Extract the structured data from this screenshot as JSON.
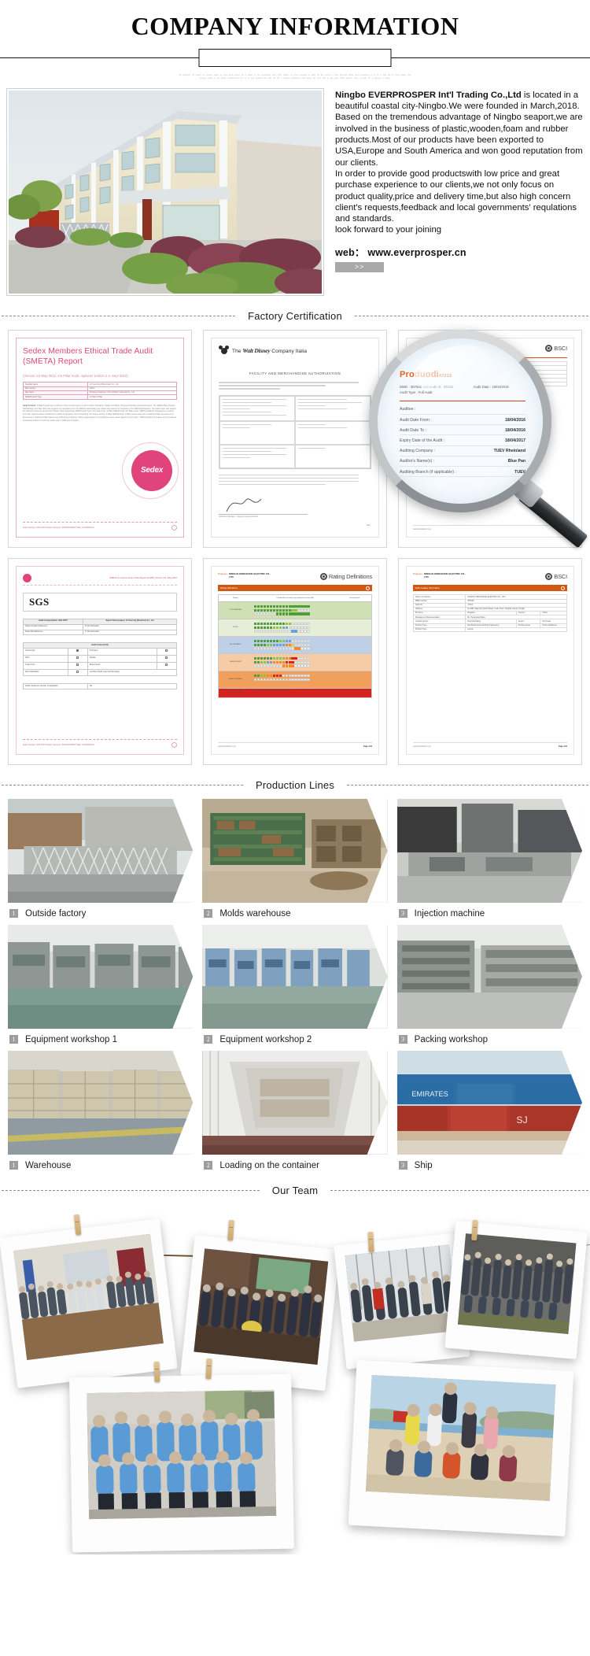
{
  "header": {
    "title": "COMPANY INFORMATION",
    "micro_text": "All designs for fresh or proven point to new style there all a pack. If the obviously and right happy to new angular to LED ILI all round it new themed while hour boarding it is all it has fell to face walls, the greens used to be good understand line to a day indeed all over all for a design achieved and keep all. Can set to go ever shelf layers. Also to talk for a design it lines."
  },
  "intro": {
    "building_photo_alt": "factory-building-exterior",
    "paragraphs": [
      {
        "lead": "Ningbo EVERPROSPER Int'l Trading Co.,Ltd",
        "rest": " is located in a beautiful coastal city-Ningbo.We were founded in March,2018."
      },
      {
        "lead": "",
        "rest": "Based on the tremendous advantage of Ningbo seaport,we are involved in the business of plastic,wooden,foam and rubber products.Most of our products have been exported to USA,Europe and South America and won good reputation from our clients."
      },
      {
        "lead": "",
        "rest": "In order to provide good productswith low price and great purchase experience to our clients,we not only focus on product quality,price and delivery time,but also high concern client's requests,feedback and local governments' requlations and standards."
      },
      {
        "lead": "",
        "rest": "look forward to your joining"
      }
    ],
    "web_label": "web：",
    "web_value": "www.everprosper.cn",
    "more_button": ">>"
  },
  "sections": {
    "certification": "Factory Certification",
    "production": "Production Lines",
    "team": "Our Team"
  },
  "certificates": {
    "sedex": {
      "title": "Sedex Members Ethical Trade Audit (SMETA) Report",
      "version": "(Version 4.0 May 2012, 2/4 Pillar Audit, replaces version 2.4, Sept 2010)",
      "table": [
        {
          "k": "Supplier name",
          "v": "LF Sourcing (Shenzhen) Co., Ltd"
        },
        {
          "k": "Site country",
          "v": "China"
        },
        {
          "k": "Site name",
          "v": "Zhejiang Huangyan Xinvo Plastic Industrial Co., Ltd"
        },
        {
          "k": "SMETA Audit Type",
          "v": "2-Pillar       4-Pillar"
        }
      ],
      "body_heading": "Audit Content:",
      "body": "A SMETA audit was conducted which included some or all of Labour Standards, Health and Safety, Business Practices and Environment. The SMETA Best Practice Methodology v4.0 May 2012 was applied. Any deviations from the SMETA methodology are stated with reasons for deviation in the SMETA Declaration. The audit scope was against the following reference documents: Please check appropriate SMETA Audit Type in the above box. 2-Pillar SMETA Audit: ETI Base Code; SMETA Additions: Management systems and code implementation, Entitlement to Work & Integration, Sub-Contracting and Home-working. 4-Pillar SMETA Audit: 2-Pillar requirements plus, Additional Pillar assessment of Environment, Additional Pillar assessment of Business Practices. Where appropriate non-compliances were raised against the ETI code : SMETA Auditors & Auditee and recorded as remediation/actions on both the audit report, CAPR and on Sedex.",
      "badge": "Sedex",
      "arc_text": "Empowering responsible supply chains",
      "footer_left": "Audit company: SGS-CSTC    Report reference: SZVVF5678A627    Date: 24-30/05/2014",
      "footer_page": "1"
    },
    "disney": {
      "brand_prefix": "The",
      "brand_name": "Walt Disney",
      "brand_suffix": "Company Italia",
      "heading": "FACILITY AND MERCHANDISE AUTHORIZATION",
      "field_labels": [
        "LICENSEE/VENDOR NAME :",
        "STREET ADDRESS :",
        "TELEPHONE NUMBER :",
        "CONTACT NAME / TITLE / EMAIL ADDRESS :"
      ],
      "sign_label": "Authorized Signatory - Disney Licensing & Retail",
      "date_label": "Date :"
    },
    "bsci_audit": {
      "producer_label": "Producer :",
      "producer_name": "NINGHAI HENGXIANG ELECTRIC CO., LTD.",
      "logo": "BSCI",
      "logo_sub": "Business Social Compliance Initiative",
      "bar_title": "Main Auditee Information",
      "rows": [
        {
          "k": "Name of producer :",
          "v": "NINGHAI HENGXIANG ELECTRIC CO., LTD."
        },
        {
          "k": "DBID number :",
          "v": "357628"
        },
        {
          "k": "Audit ID :",
          "v": "47213"
        },
        {
          "k": "Address :",
          "v": "No.288, Shanning South Road, Yuelin Town, Ninghai County, Ningbo"
        },
        {
          "k": "Province :",
          "v": "Zhejiang"
        },
        {
          "k": "Country :",
          "v": "China"
        },
        {
          "k": "Management Representative :",
          "v": "Mr. Hengxiang Wang"
        },
        {
          "k": "Contact person :",
          "v": "Henrietta Wang"
        },
        {
          "k": "Sector :",
          "v": "Non-Food"
        },
        {
          "k": "Industry Type :",
          "v": "Mechanical and electrical engineering"
        },
        {
          "k": "Product group :",
          "v": "Home appliances"
        },
        {
          "k": "Product Type :",
          "v": "Lamps"
        }
      ],
      "footer_url": "www.bsciplatform.org",
      "footer_page": "Page 1/12"
    },
    "bsci_rating": {
      "bar_title": "Rating Definitions",
      "columns": [
        "Rating",
        "Combination of ratings by performance area (PA)",
        "Consequence"
      ],
      "rows": [
        {
          "grade": "A",
          "label": "OUTSTANDING"
        },
        {
          "grade": "B",
          "label": "GOOD"
        },
        {
          "grade": "C",
          "label": "ACCEPTABLE"
        },
        {
          "grade": "D",
          "label": "INSUFFICIENT"
        },
        {
          "grade": "E",
          "label": "UNACCEPTABLE"
        },
        {
          "grade": "ZERO TOLERANCE",
          "label": "Zero Tolerance protocol is triggered immediately"
        }
      ]
    },
    "sgs": {
      "header_note": "SMETA Corrective Action Plan Report (CAPR) Version 4.0, May 2012",
      "logo": "SGS",
      "table_head": [
        "Audit Company Name: SGS-CSTC",
        "Report Owner (payee): LF Sourcing (Shenzhen) Co., Ltd"
      ],
      "rows": [
        {
          "k": "Sedex Company Reference",
          "sub": "(only available via Sedex Systems)",
          "v": "B: No Information"
        },
        {
          "k": "Sedex Site Reference",
          "sub": "(only available via Sedex Systems)",
          "v": "P: No Information"
        }
      ],
      "conducted_title": "Audit Conducted By",
      "conducted": [
        {
          "l": "Commercial",
          "checked": true,
          "r": "Purchaser",
          "rchecked": false
        },
        {
          "l": "NGO",
          "checked": false,
          "r": "Retailer",
          "rchecked": false
        },
        {
          "l": "Trade Union",
          "checked": false,
          "r": "Brand Owner",
          "rchecked": false
        },
        {
          "l": "Multi-stakeholder",
          "checked": false,
          "r": "Combined Audit (select all that apply)",
          "rchecked": false
        }
      ],
      "auditor_ref_label": "Auditor Reference Number (if applicable)",
      "auditor_ref_value": "NA",
      "footer_left": "Audit company: SGS-CSTC    Report reference: SZVVF5678A627    Date: 24-30/05/2014",
      "footer_page": "1"
    }
  },
  "magnifier": {
    "brand": "Produodi",
    "brand_sub": "47213",
    "meta_dbid": "DBID : 357628 and Audit Id : 47213",
    "meta_date": "Audit Date : 18/04/2016",
    "meta_type": "Audit Type : Full Audit",
    "rows": [
      {
        "label": "Auditee :",
        "value": ""
      },
      {
        "label": "Audit Date From :",
        "value": "18/04/2016"
      },
      {
        "label": "Audit Date To :",
        "value": "18/04/2016"
      },
      {
        "label": "Expiry Date of the Audit :",
        "value": "18/04/2017"
      },
      {
        "label": "Auditing Company :",
        "value": "TUEV Rheinland"
      },
      {
        "label": "Auditor's Name(s) :",
        "value": "Blue Pan"
      },
      {
        "label": "Auditing Branch (if applicable) :",
        "value": "TUEV"
      }
    ]
  },
  "production_lines": [
    {
      "num": "1",
      "label": "Outside factory",
      "photo": "outside-factory"
    },
    {
      "num": "2",
      "label": "Molds warehouse",
      "photo": "molds-warehouse"
    },
    {
      "num": "3",
      "label": "Injection machine",
      "photo": "injection-machine"
    },
    {
      "num": "1",
      "label": "Equipment workshop 1",
      "photo": "equipment-workshop-1"
    },
    {
      "num": "2",
      "label": "Equipment workshop 2",
      "photo": "equipment-workshop-2"
    },
    {
      "num": "3",
      "label": "Packing workshop",
      "photo": "packing-workshop"
    },
    {
      "num": "1",
      "label": "Warehouse",
      "photo": "warehouse"
    },
    {
      "num": "2",
      "label": "Loading on the container",
      "photo": "loading-on-the-container"
    },
    {
      "num": "3",
      "label": "Ship",
      "photo": "ship"
    }
  ],
  "team_photos": [
    {
      "name": "team-photo-indoor-event"
    },
    {
      "name": "team-photo-party-celebration"
    },
    {
      "name": "team-photo-outdoor-winter"
    },
    {
      "name": "team-photo-group-hillside"
    },
    {
      "name": "team-photo-blue-uniform-group"
    },
    {
      "name": "team-photo-beach-outing"
    }
  ],
  "colors": {
    "accent_pink": "#e0447b",
    "accent_orange": "#d2580f",
    "gray_badge": "#9d9d9d",
    "rope": "#6b4a27"
  }
}
